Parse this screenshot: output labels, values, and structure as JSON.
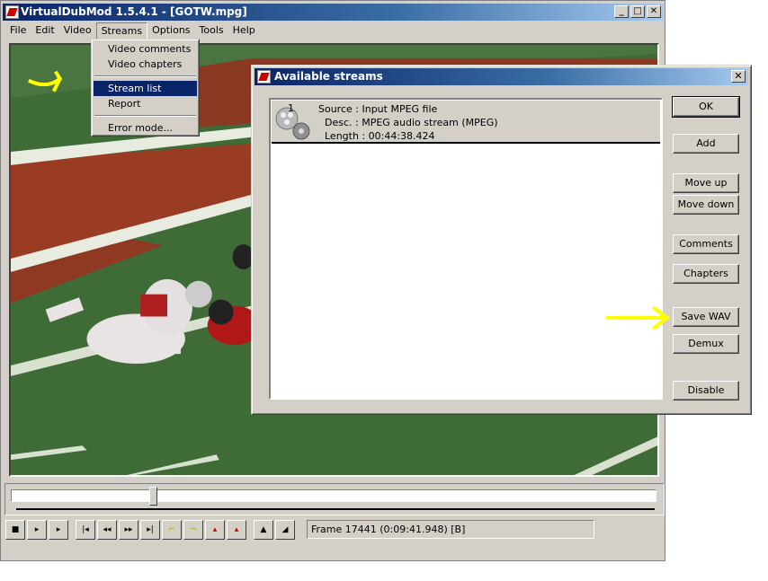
{
  "window": {
    "title": "VirtualDubMod 1.5.4.1 - [GOTW.mpg]",
    "min": "_",
    "max": "□",
    "close": "✕"
  },
  "menu": [
    {
      "label": "File"
    },
    {
      "label": "Edit"
    },
    {
      "label": "Video"
    },
    {
      "label": "Streams"
    },
    {
      "label": "Options"
    },
    {
      "label": "Tools"
    },
    {
      "label": "Help"
    }
  ],
  "streams_menu": [
    {
      "label": "Video comments"
    },
    {
      "label": "Video chapters"
    },
    {
      "label": "Stream list"
    },
    {
      "label": "Report"
    },
    {
      "label": "Error mode..."
    }
  ],
  "status": {
    "frame": "Frame 17441 (0:09:41.948) [B]"
  },
  "seek": {
    "position": 0.22
  },
  "dialog": {
    "title": "Available streams",
    "close": "✕",
    "stream": {
      "number": "1",
      "source": "Source : Input MPEG file",
      "desc": "Desc. : MPEG audio stream (MPEG)",
      "length": "Length : 00:44:38.424"
    },
    "buttons": {
      "ok": "OK",
      "add": "Add",
      "move_up": "Move up",
      "move_down": "Move down",
      "comments": "Comments",
      "chapters": "Chapters",
      "save_wav": "Save WAV",
      "demux": "Demux",
      "disable": "Disable"
    }
  },
  "colors": {
    "title_bar": "#0a246a",
    "highlight": "#0a246a",
    "annotation_arrow": "#ffff00"
  }
}
